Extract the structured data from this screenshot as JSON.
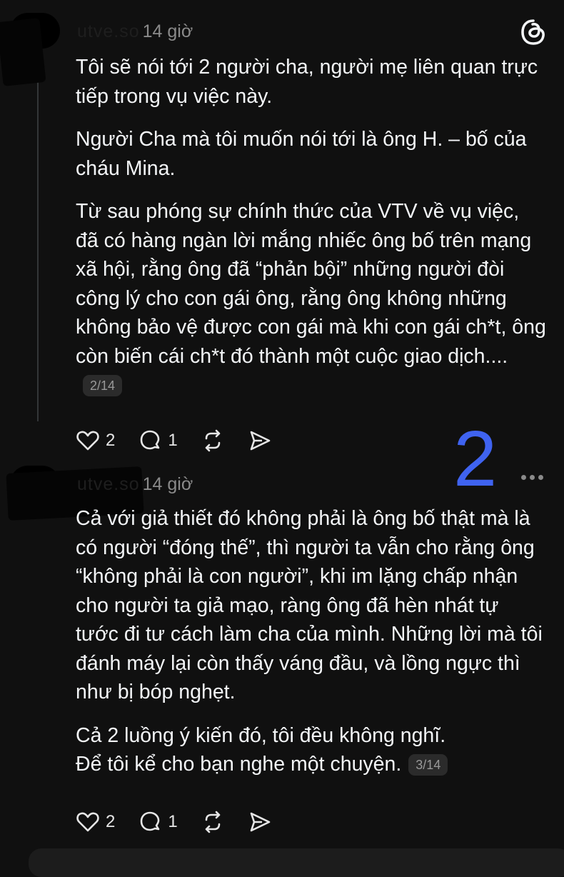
{
  "posts": [
    {
      "username": "utve.so",
      "time": "14 giờ",
      "paragraphs": [
        "Tôi sẽ nói tới 2 người cha, người mẹ liên quan trực tiếp trong vụ việc này.",
        "Người Cha mà tôi muốn nói tới là ông H. – bố của cháu Mina.",
        "Từ sau phóng sự chính thức của VTV về vụ việc, đã có hàng ngàn lời mắng nhiếc ông bố trên mạng xã hội, rằng ông đã “phản bội” những người đòi công lý cho con gái ông, rằng ông không những không bảo vệ được con gái mà khi con gái ch*t, ông còn biến cái ch*t đó thành một cuộc giao dịch...."
      ],
      "page": "2/14",
      "likes": "2",
      "replies": "1"
    },
    {
      "username": "utve.so",
      "time": "14 giờ",
      "paragraphs": [
        "Cả với giả thiết đó không phải là ông bố thật mà là có người “đóng thế”, thì người ta vẫn cho rằng ông “không phải là con người”, khi im lặng chấp nhận cho người ta giả mạo, ràng ông đã hèn nhát tự tước đi tư cách làm cha của mình. Những lời mà tôi đánh máy lại còn thấy váng đầu, và lồng ngực thì như bị bóp nghẹt.",
        "Cả 2 luồng ý kiến đó, tôi đều không nghĩ.",
        "Để tôi kể cho bạn nghe một chuyện."
      ],
      "page": "3/14",
      "likes": "2",
      "replies": "1"
    }
  ],
  "annotation_number": "2",
  "colors": {
    "background": "#101010",
    "text": "#f3f5f7",
    "muted": "#8a8a8a",
    "annotation": "#3f63f0"
  },
  "icons": [
    "threads-logo-icon",
    "heart-icon",
    "comment-icon",
    "repost-icon",
    "share-icon",
    "more-icon"
  ]
}
